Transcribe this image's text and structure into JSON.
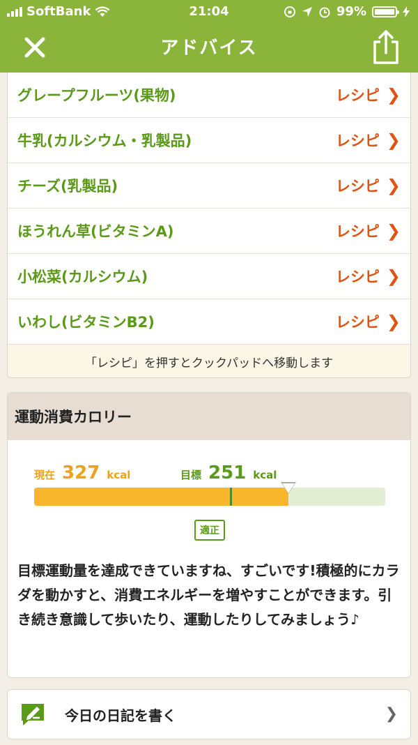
{
  "status": {
    "carrier": "SoftBank",
    "time": "21:04",
    "battery": "99%"
  },
  "nav": {
    "title": "アドバイス"
  },
  "recipes": {
    "link_label": "レシピ",
    "items": [
      {
        "name": "グレープフルーツ(果物)"
      },
      {
        "name": "牛乳(カルシウム・乳製品)"
      },
      {
        "name": "チーズ(乳製品)"
      },
      {
        "name": "ほうれん草(ビタミンA)"
      },
      {
        "name": "小松菜(カルシウム)"
      },
      {
        "name": "いわし(ビタミンB2)"
      }
    ],
    "note": "「レシピ」を押すとクックパッドへ移動します"
  },
  "exercise": {
    "title": "運動消費カロリー",
    "current_label": "現在",
    "current_value": "327",
    "target_label": "目標",
    "target_value": "251",
    "unit": "kcal",
    "bar": {
      "current_fraction": 0.725,
      "target_fraction": 0.56
    },
    "badge": "適正",
    "message": "目標運動量を達成できていますね、すごいです!積極的にカラダを動かすと、消費エネルギーを増やすことができます。引き続き意識して歩いたり、運動したりしてみましょう♪"
  },
  "diary": {
    "label": "今日の日記を書く"
  },
  "colors": {
    "brand_green": "#8ab43a",
    "text_green": "#5a9a18",
    "recipe_orange": "#e05312",
    "bar_orange": "#f7b62b"
  }
}
